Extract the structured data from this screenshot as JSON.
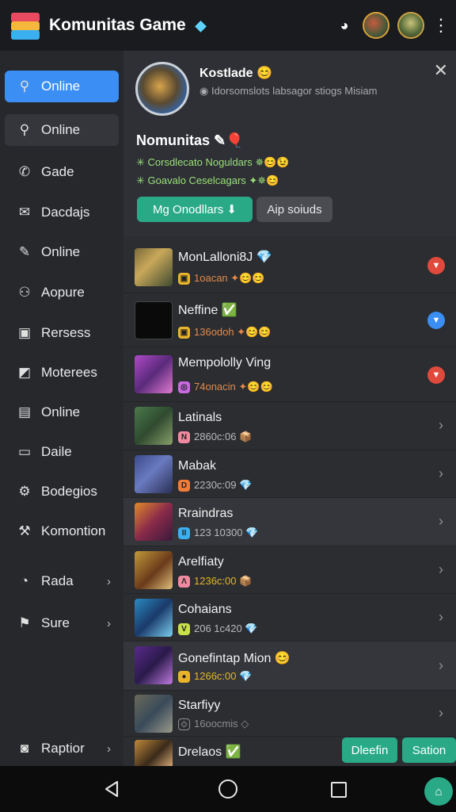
{
  "app": {
    "title": "Komunitas Game",
    "title_badge": "◆"
  },
  "sidebar": {
    "items": [
      {
        "label": "Online",
        "icon": "search-icon",
        "glyph": "⚲",
        "state": "active"
      },
      {
        "label": "Online",
        "icon": "search-icon",
        "glyph": "⚲",
        "state": "boxed"
      },
      {
        "label": "Gade",
        "icon": "phone-icon",
        "glyph": "✆"
      },
      {
        "label": "Dacdajs",
        "icon": "mail-icon",
        "glyph": "✉"
      },
      {
        "label": "Online",
        "icon": "pencil-icon",
        "glyph": "✎"
      },
      {
        "label": "Aopure",
        "icon": "user-icon",
        "glyph": "⚇"
      },
      {
        "label": "Rersess",
        "icon": "building-icon",
        "glyph": "▣"
      },
      {
        "label": "Moterees",
        "icon": "chart-icon",
        "glyph": "◩"
      },
      {
        "label": "Online",
        "icon": "building-icon",
        "glyph": "▤"
      },
      {
        "label": "Daile",
        "icon": "document-icon",
        "glyph": "▭"
      },
      {
        "label": "Bodegios",
        "icon": "gear-icon",
        "glyph": "⚙"
      },
      {
        "label": "Komontion",
        "icon": "wrench-icon",
        "glyph": "⚒"
      },
      {
        "label": "Rada",
        "icon": "compass-icon",
        "glyph": "◔",
        "chevron": "›"
      },
      {
        "label": "Sure",
        "icon": "flag-icon",
        "glyph": "⚑",
        "chevron": "›"
      },
      {
        "label": "Raptior",
        "icon": "window-icon",
        "glyph": "◙",
        "chevron": "›"
      }
    ]
  },
  "profile": {
    "name": "Kostlade 😊",
    "subtitle": "◉ Idorsomslots labsagor stiogs Misiam",
    "close": "✕",
    "community_title": "Nomunitas ✎🎈",
    "line1": "✳ Corsdlecato Noguldars ✵😊😉",
    "line2": "✳ Goavalo Ceselcagars ✦✵😊",
    "primary_button": "Mg Onodllars ⬇",
    "secondary_button": "Aip soiuds"
  },
  "games": [
    {
      "name": "MonLalloni8J 💎",
      "meta": "1oacan ✦😊😊",
      "badge": "▣",
      "badge_color": "#e8b52a",
      "meta_color": "#e4894a",
      "pin": "▼",
      "pin_color": "#e04a3c",
      "highlight": false
    },
    {
      "name": "Neffine ✅",
      "meta": "136odoh ✦😊😊",
      "badge": "▣",
      "badge_color": "#e8b52a",
      "meta_color": "#e4894a",
      "pin": "▼",
      "pin_color": "#3b8ef3",
      "highlight": false
    },
    {
      "name": "Mempololly Ving",
      "meta": "74onacin ✦😊😊",
      "badge": "◎",
      "badge_color": "#c86ae0",
      "meta_color": "#e4894a",
      "pin": "▼",
      "pin_color": "#e04a3c",
      "highlight": false
    },
    {
      "name": "Latinals",
      "meta": "2860c:06 📦",
      "badge": "N",
      "badge_color": "#f08aa0",
      "meta_color": "#b8b9bd",
      "chevron": "›",
      "highlight": false
    },
    {
      "name": "Mabak",
      "meta": "2230c:09 💎",
      "badge": "D",
      "badge_color": "#f07c3a",
      "meta_color": "#b8b9bd",
      "chevron": "›",
      "highlight": false
    },
    {
      "name": "Rraindras",
      "meta": "123 10300 💎",
      "badge": "II",
      "badge_color": "#3bb0f0",
      "meta_color": "#b8b9bd",
      "chevron": "›",
      "highlight": true
    },
    {
      "name": "Arelfiaty",
      "meta": "1236c:00 📦",
      "badge": "Λ",
      "badge_color": "#f08aa0",
      "meta_color": "#e8b52a",
      "chevron": "›",
      "highlight": false
    },
    {
      "name": "Cohaians",
      "meta": "206 1c420 💎",
      "badge": "V",
      "badge_color": "#c8e04a",
      "meta_color": "#b8b9bd",
      "chevron": "›",
      "highlight": false
    },
    {
      "name": "Gonefintap Mion 😊",
      "meta": "1266c:00 💎",
      "badge": "●",
      "badge_color": "#e8b52a",
      "meta_color": "#e8b52a",
      "chevron": "›",
      "highlight": true
    },
    {
      "name": "Starfiyy",
      "meta": "16oocmis ◇",
      "badge": "◇",
      "badge_color": "#8a8c90",
      "meta_color": "#8a8c90",
      "chevron": "›",
      "highlight": false
    },
    {
      "name": "Drelaos ✅",
      "meta": "",
      "badge": "",
      "badge_color": "#8a8c90",
      "meta_color": "#8a8c90",
      "highlight": false
    }
  ],
  "floating": {
    "left_button": "Dleefin",
    "right_button": "Sation"
  },
  "navbar": {
    "fab_glyph": "⌂"
  },
  "colors": {
    "accent": "#3b8ef3",
    "green": "#2aa987",
    "background": "#1e2024"
  }
}
